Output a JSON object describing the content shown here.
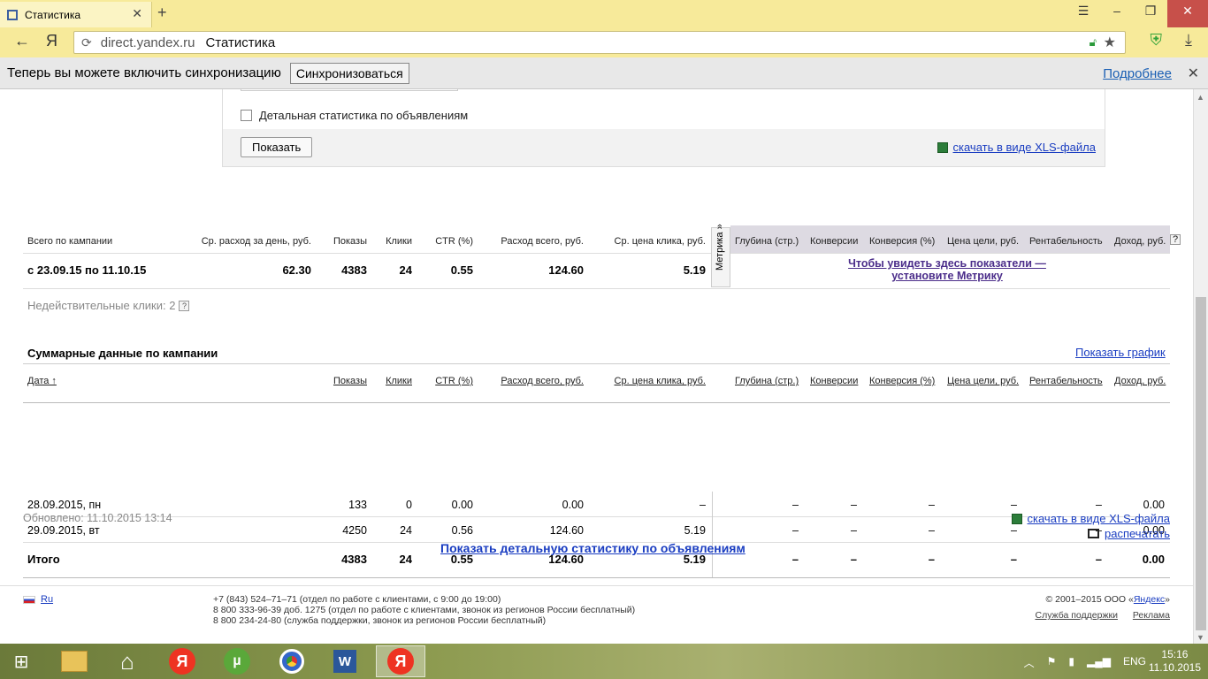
{
  "browser": {
    "tab_title": "Статистика",
    "url_host": "direct.yandex.ru",
    "page_title": "Статистика",
    "sync_text": "Теперь вы можете включить синхронизацию",
    "sync_button": "Синхронизоваться",
    "sync_more": "Подробнее"
  },
  "filters": {
    "detail_checkbox_label": "Детальная статистика по объявлениям",
    "detail_checked": false,
    "show_button": "Показать",
    "xls_link": "скачать в виде XLS-файла"
  },
  "summary": {
    "headers": [
      "Всего по кампании",
      "Ср. расход за день, руб.",
      "Показы",
      "Клики",
      "CTR (%)",
      "Расход всего, руб.",
      "Ср. цена клика, руб."
    ],
    "metrika_headers": [
      "Глубина (стр.)",
      "Конверсии",
      "Конверсия (%)",
      "Цена цели, руб.",
      "Рентабельность",
      "Доход, руб."
    ],
    "metrika_tab": "Метрика »",
    "row": [
      "с 23.09.15 по 11.10.15",
      "62.30",
      "4383",
      "24",
      "0.55",
      "124.60",
      "5.19"
    ],
    "metrika_link_line1": "Чтобы увидеть здесь показатели —",
    "metrika_link_line2": "установите Метрику",
    "help": "?"
  },
  "invalid_clicks": "Недействительные клики: 2",
  "detail": {
    "title": "Суммарные данные по кампании",
    "graph_link": "Показать график",
    "headers": [
      "Дата ↑",
      "Показы",
      "Клики",
      "CTR (%)",
      "Расход всего, руб.",
      "Ср. цена клика, руб.",
      "Глубина (стр.)",
      "Конверсии",
      "Конверсия (%)",
      "Цена цели, руб.",
      "Рентабельность",
      "Доход, руб."
    ],
    "rows": [
      [
        "28.09.2015, пн",
        "133",
        "0",
        "0.00",
        "0.00",
        "–",
        "–",
        "–",
        "–",
        "–",
        "–",
        "0.00"
      ],
      [
        "29.09.2015, вт",
        "4250",
        "24",
        "0.56",
        "124.60",
        "5.19",
        "–",
        "–",
        "–",
        "–",
        "–",
        "0.00"
      ]
    ],
    "total": [
      "Итого",
      "4383",
      "24",
      "0.55",
      "124.60",
      "5.19",
      "–",
      "–",
      "–",
      "–",
      "–",
      "0.00"
    ]
  },
  "updated": "Обновлено: 11.10.2015 13:14",
  "xls_link2": "скачать в виде XLS-файла",
  "print_link": "распечатать",
  "detail_stats_link": "Показать детальную статистику по объявлениям",
  "footer": {
    "lang": "Ru",
    "contact1": "+7 (843) 524–71–71 (отдел по работе с клиентами, с 9:00 до 19:00)",
    "contact2": "8 800 333-96-39 доб. 1275 (отдел по работе с клиентами, звонок из регионов России бесплатный)",
    "contact3": "8 800 234-24-80 (служба поддержки, звонок из регионов России бесплатный)",
    "copyright_prefix": "© 2001–2015  ООО «",
    "copyright_link": "Яндекс",
    "copyright_suffix": "»",
    "support_link": "Служба поддержки",
    "ads_link": "Реклама"
  },
  "taskbar": {
    "lang": "ENG",
    "time": "15:16",
    "date": "11.10.2015",
    "yandex_letter": "Я",
    "utorrent_letter": "µ",
    "word_letter": "W"
  }
}
